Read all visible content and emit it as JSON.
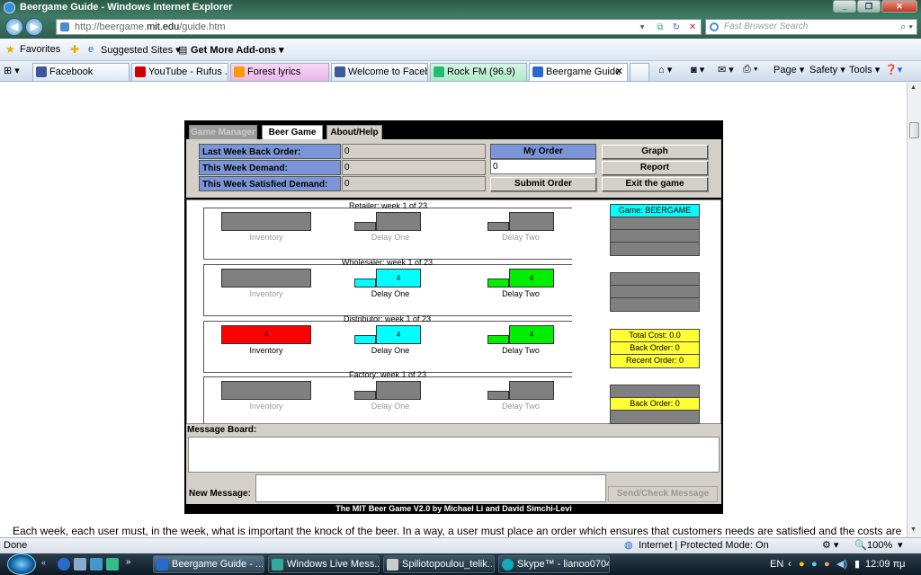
{
  "window": {
    "title": "Beergame Guide - Windows Internet Explorer"
  },
  "address": {
    "prefix": "http://beergame.",
    "domain": "mit.edu",
    "path": "/guide.htm"
  },
  "search": {
    "placeholder": "Fast Browser Search"
  },
  "favbar": {
    "favorites": "Favorites",
    "suggested": "Suggested Sites ▾",
    "addons": "Get More Add-ons ▾"
  },
  "tabs": [
    "Facebook",
    "YouTube - Rufus ...",
    "Forest lyrics",
    "Welcome to Faceb...",
    "Rock FM (96.9)",
    "Beergame Guide"
  ],
  "commands": {
    "page": "Page ▾",
    "safety": "Safety ▾",
    "tools": "Tools ▾"
  },
  "applet": {
    "tabs": {
      "manager": "Game Manager",
      "beer": "Beer Game",
      "help": "About/Help"
    },
    "labels": {
      "backorder": "Last Week Back Order:",
      "demand": "This Week Demand:",
      "satisfied": "This Week Satisfied Demand:"
    },
    "values": {
      "backorder": "0",
      "demand": "0",
      "satisfied": "0"
    },
    "my_order": "My Order",
    "order_value": "0",
    "buttons": {
      "submit": "Submit Order",
      "graph": "Graph",
      "report": "Report",
      "exit": "Exit the game"
    },
    "stages": [
      {
        "title": "Retailer: week 1 of 23",
        "inv": "Inventory",
        "d1": "Delay One",
        "d2": "Delay Two",
        "inv_val": "",
        "d1_val": "",
        "d2_val": ""
      },
      {
        "title": "Wholesaler: week 1 of 23",
        "inv": "Inventory",
        "d1": "Delay One",
        "d2": "Delay Two",
        "inv_val": "",
        "d1_val": "4",
        "d2_val": "4"
      },
      {
        "title": "Distributor: week 1 of 23",
        "inv": "Inventory",
        "d1": "Delay One",
        "d2": "Delay Two",
        "inv_val": "4",
        "d1_val": "4",
        "d2_val": "4"
      },
      {
        "title": "Factory: week 1 of 23",
        "inv": "Inventory",
        "d1": "Delay One",
        "d2": "Delay Two",
        "inv_val": "",
        "d1_val": "",
        "d2_val": ""
      }
    ],
    "game_name": "Game: BEERGAME",
    "total_cost": "Total Cost: 0.0",
    "back_order": "Back Order: 0",
    "recent_order": "Recent Order: 0",
    "factory_back_order": "Back Order: 0",
    "message_board": "Message Board:",
    "new_message": "New Message:",
    "send": "Send/Check Message",
    "footer": "The MIT Beer Game V2.0 by Michael Li and David Simchi-Levi"
  },
  "below_text": "Each week, each user must, in the week, what is important the knock of the beer. In a way, a user must place an order which ensures that customers needs are satisfied and the costs are as low as possible. N",
  "status": {
    "left": "Done",
    "zone": "Internet | Protected Mode: On",
    "zoom": "100%"
  },
  "taskbar": {
    "items": [
      "Beergame Guide - ...",
      "Windows Live Mess...",
      "Spiliotopoulou_telik...",
      "Skype™ - lianoo0704"
    ],
    "lang": "EN",
    "clock": "12:09 πμ"
  },
  "colors": {
    "red": "#ff0000",
    "cyan": "#00ffff",
    "green": "#00ee00",
    "yellow": "#ffff33",
    "gray": "#808080",
    "blue_label": "#7b96d6"
  }
}
